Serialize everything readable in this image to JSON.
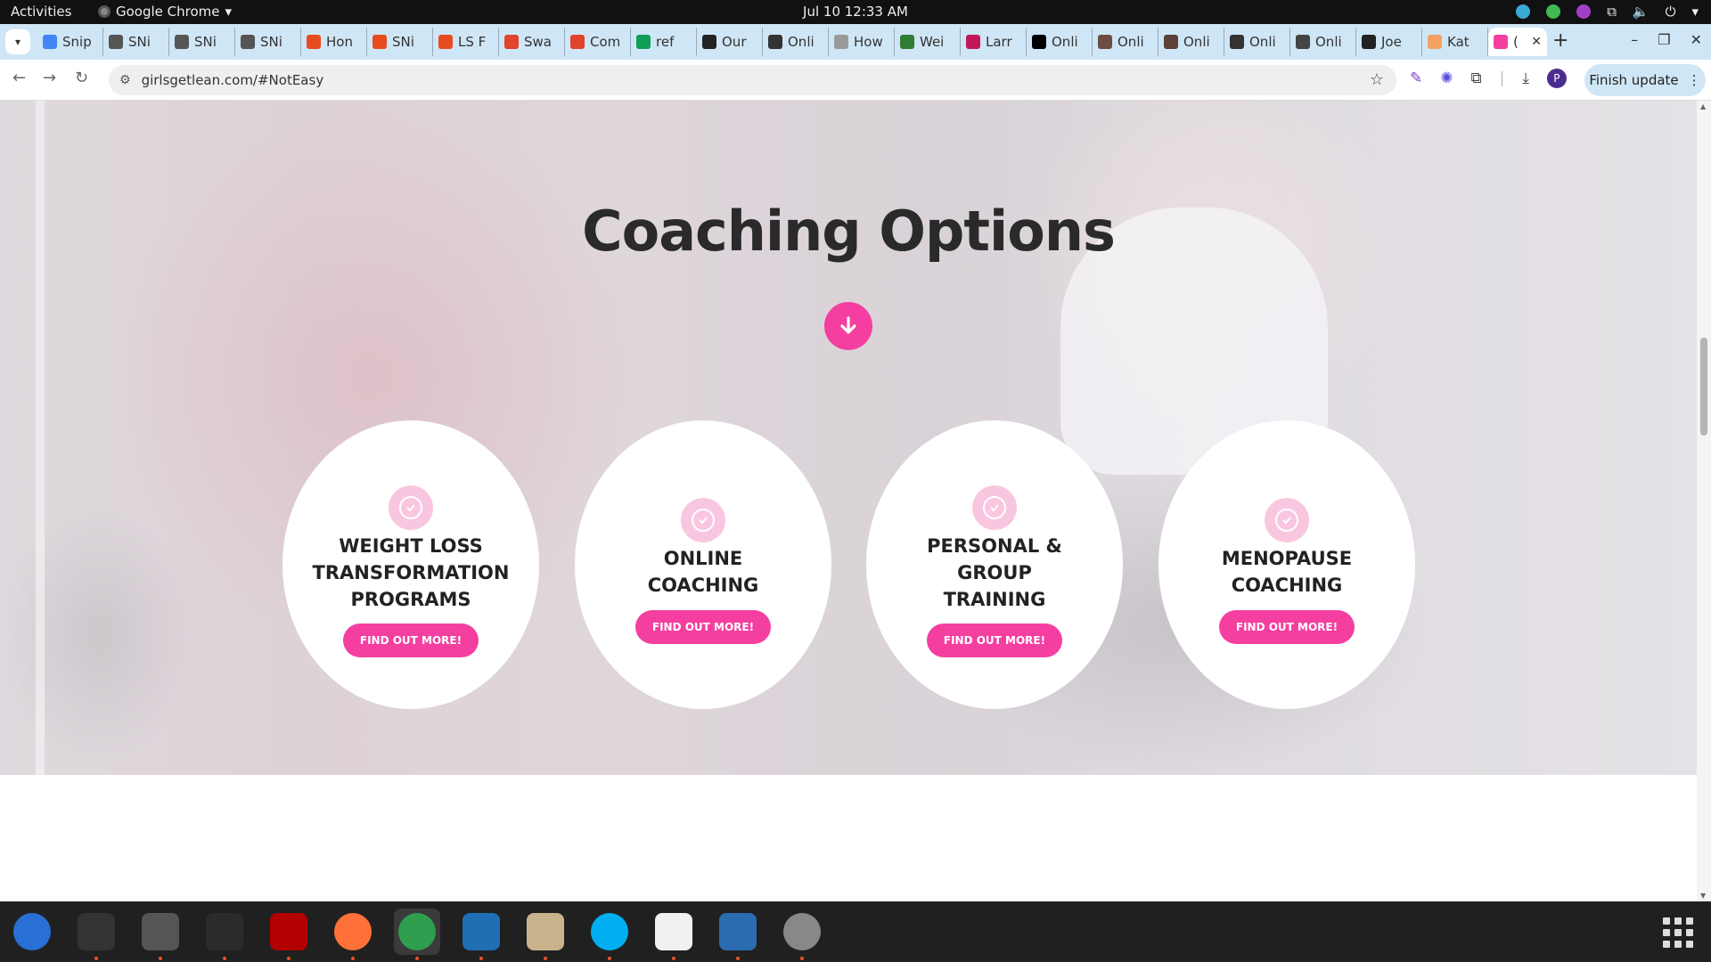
{
  "system_bar": {
    "activities": "Activities",
    "app_name": "Google Chrome",
    "datetime": "Jul 10  12:33 AM"
  },
  "tabs": [
    {
      "label": "Snip",
      "favicon_color": "#4285f4"
    },
    {
      "label": "SNi",
      "favicon_color": "#555555"
    },
    {
      "label": "SNi",
      "favicon_color": "#555555"
    },
    {
      "label": "SNi",
      "favicon_color": "#555555"
    },
    {
      "label": "Hon",
      "favicon_color": "#e84c1e"
    },
    {
      "label": "SNi",
      "favicon_color": "#e84c1e"
    },
    {
      "label": "LS F",
      "favicon_color": "#e84c1e"
    },
    {
      "label": "Swa",
      "favicon_color": "#e24329"
    },
    {
      "label": "Com",
      "favicon_color": "#e24329"
    },
    {
      "label": "ref",
      "favicon_color": "#0f9d58"
    },
    {
      "label": "Our",
      "favicon_color": "#222222"
    },
    {
      "label": "Onli",
      "favicon_color": "#333333"
    },
    {
      "label": "How",
      "favicon_color": "#999999"
    },
    {
      "label": "Wei",
      "favicon_color": "#2e7d32"
    },
    {
      "label": "Larr",
      "favicon_color": "#c2185b"
    },
    {
      "label": "Onli",
      "favicon_color": "#000000"
    },
    {
      "label": "Onli",
      "favicon_color": "#6d4c41"
    },
    {
      "label": "Onli",
      "favicon_color": "#5d4037"
    },
    {
      "label": "Onli",
      "favicon_color": "#333333"
    },
    {
      "label": "Onli",
      "favicon_color": "#444444"
    },
    {
      "label": "Joe",
      "favicon_color": "#222222"
    },
    {
      "label": "Kat",
      "favicon_color": "#f4a261"
    }
  ],
  "active_tab": {
    "label": "(",
    "favicon_color": "#f43fa0"
  },
  "toolbar": {
    "url": "girlsgetlean.com/#NotEasy",
    "profile_initial": "P",
    "finish_update": "Finish update"
  },
  "page": {
    "title": "Coaching Options",
    "options": [
      {
        "heading": "WEIGHT LOSS TRANSFORMATION PROGRAMS",
        "button": "FIND OUT MORE!"
      },
      {
        "heading": "ONLINE COACHING",
        "button": "FIND OUT MORE!"
      },
      {
        "heading": "PERSONAL & GROUP TRAINING",
        "button": "FIND OUT MORE!"
      },
      {
        "heading": "MENOPAUSE COACHING",
        "button": "FIND OUT MORE!"
      }
    ],
    "accent_color": "#f43fa0"
  },
  "dock": {
    "apps": [
      "thunderbird-icon",
      "terminal-icon",
      "calculator-icon",
      "system-monitor-icon",
      "filezilla-icon",
      "firefox-icon",
      "chrome-icon",
      "vscode-icon",
      "files-icon",
      "skype-icon",
      "text-editor-icon",
      "document-viewer-icon",
      "disk-icon"
    ]
  }
}
